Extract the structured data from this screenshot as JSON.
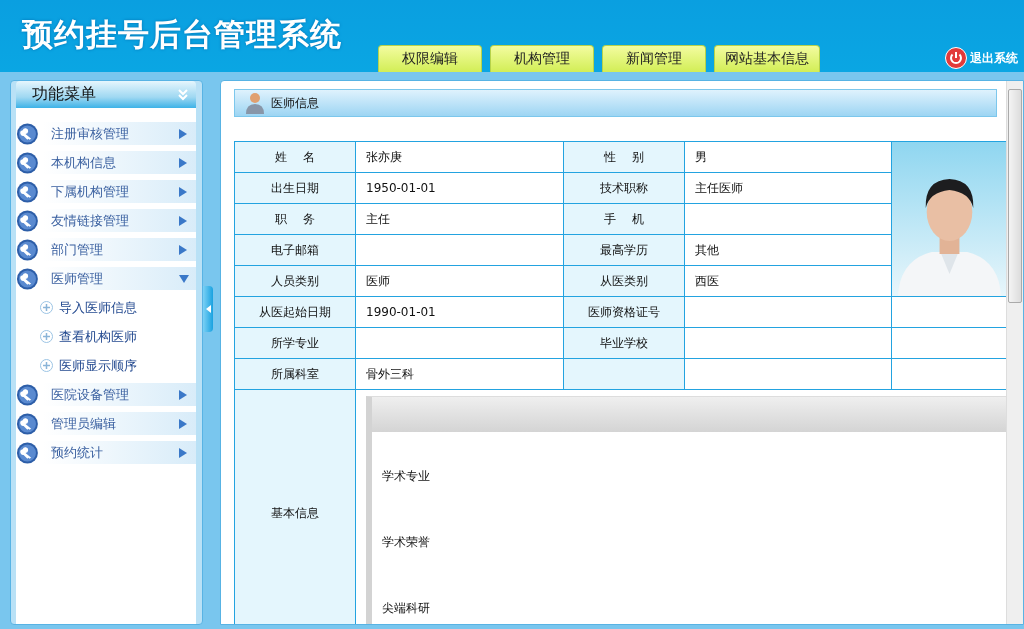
{
  "header": {
    "title": "预约挂号后台管理系统",
    "logout": "退出系统",
    "tabs": [
      {
        "label": "权限编辑",
        "selected": false
      },
      {
        "label": "机构管理",
        "selected": false
      },
      {
        "label": "新闻管理",
        "selected": false
      },
      {
        "label": "网站基本信息",
        "selected": false
      }
    ]
  },
  "sidebar": {
    "title": "功能菜单",
    "items": [
      {
        "label": "注册审核管理",
        "expanded": false
      },
      {
        "label": "本机构信息",
        "expanded": false
      },
      {
        "label": "下属机构管理",
        "expanded": false
      },
      {
        "label": "友情链接管理",
        "expanded": false
      },
      {
        "label": "部门管理",
        "expanded": false
      },
      {
        "label": "医师管理",
        "expanded": true,
        "children": [
          {
            "label": "导入医师信息"
          },
          {
            "label": "查看机构医师"
          },
          {
            "label": "医师显示顺序"
          }
        ]
      },
      {
        "label": "医院设备管理",
        "expanded": false
      },
      {
        "label": "管理员编辑",
        "expanded": false
      },
      {
        "label": "预约统计",
        "expanded": false
      }
    ]
  },
  "panel": {
    "title": "医师信息",
    "rows": [
      {
        "fields": [
          {
            "label": "姓    名",
            "value": "张亦庚"
          },
          {
            "label": "性    别",
            "value": "男"
          }
        ]
      },
      {
        "fields": [
          {
            "label": "出生日期",
            "value": "1950-01-01"
          },
          {
            "label": "技术职称",
            "value": "主任医师"
          }
        ]
      },
      {
        "fields": [
          {
            "label": "职    务",
            "value": "主任"
          },
          {
            "label": "手    机"
          }
        ]
      },
      {
        "fields": [
          {
            "label": "电子邮箱"
          },
          {
            "label": "最高学历",
            "value": "其他"
          }
        ]
      },
      {
        "fields": [
          {
            "label": "人员类别",
            "value": "医师"
          },
          {
            "label": "从医类别",
            "value": "西医"
          }
        ]
      },
      {
        "fields": [
          {
            "label": "从医起始日期",
            "value": "1990-01-01"
          },
          {
            "label": "医师资格证号"
          }
        ]
      },
      {
        "fields": [
          {
            "label": "所学专业"
          },
          {
            "label": "毕业学校"
          }
        ]
      },
      {
        "fields": [
          {
            "label": "所属科室",
            "value": "骨外三科"
          }
        ]
      }
    ],
    "basic_info": {
      "label": "基本信息",
      "sections": [
        "学术专业",
        "学术荣誉",
        "尖端科研"
      ]
    }
  }
}
